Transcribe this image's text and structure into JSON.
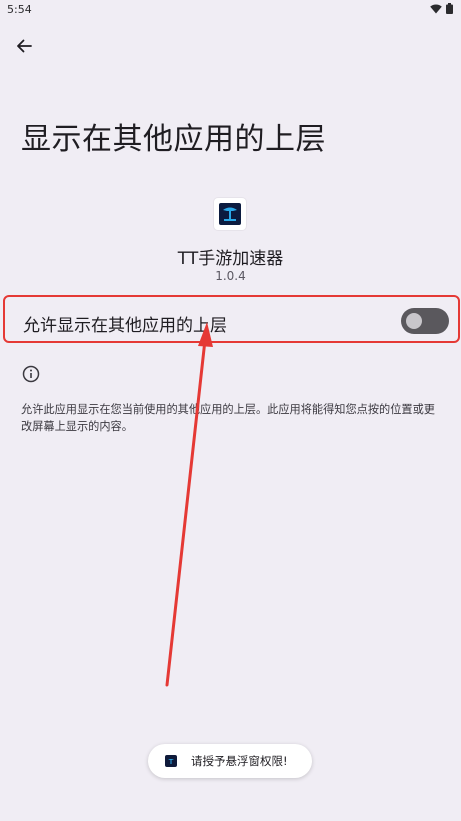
{
  "status_bar": {
    "time": "5:54",
    "icons": [
      "wifi-icon",
      "battery-icon"
    ]
  },
  "header": {
    "back_icon": "arrow-back-icon",
    "title": "显示在其他应用的上层"
  },
  "app": {
    "name": "TT手游加速器",
    "version": "1.0.4",
    "icon": "app-logo-icon"
  },
  "permission": {
    "label": "允许显示在其他应用的上层",
    "enabled": false
  },
  "info": {
    "icon": "info-icon",
    "description": "允许此应用显示在您当前使用的其他应用的上层。此应用将能得知您点按的位置或更改屏幕上显示的内容。"
  },
  "toast": {
    "text": "请授予悬浮窗权限!"
  },
  "colors": {
    "background": "#f0edf4",
    "highlight_border": "#e53935",
    "switch_track_off": "#5a585d"
  }
}
